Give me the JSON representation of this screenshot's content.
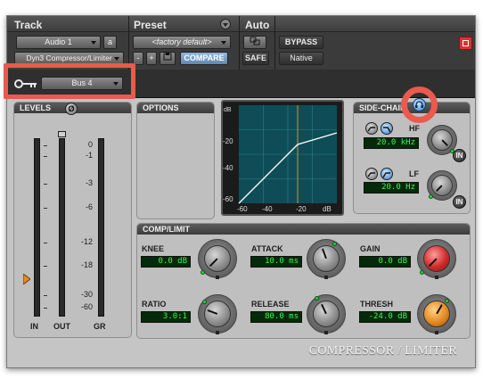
{
  "header": {
    "track_label": "Track",
    "preset_label": "Preset",
    "auto_label": "Auto",
    "track_name": "Audio 1",
    "track_channel": "a",
    "insert_name": "Dyn3 Compressor/Limiter",
    "preset_name": "<factory default>",
    "minus_label": "-",
    "plus_label": "+",
    "compare_label": "COMPARE",
    "bypass_label": "BYPASS",
    "safe_label": "SAFE",
    "native_label": "Native"
  },
  "keyinput": {
    "value": "Bus 4"
  },
  "levels": {
    "title": "LEVELS",
    "phase_icon": "Ø",
    "scale": [
      "0",
      "-1",
      "-3",
      "-6",
      "-12",
      "-18",
      "-30",
      "-60"
    ],
    "labels": [
      "IN",
      "OUT",
      "GR"
    ]
  },
  "options": {
    "title": "OPTIONS"
  },
  "graph": {
    "y_ticks": [
      "dB",
      "-20",
      "-40",
      "-60"
    ],
    "x_ticks": [
      "-60",
      "-40",
      "-20",
      "dB"
    ]
  },
  "sidechain": {
    "title": "SIDE-CHAIN",
    "hf_label": "HF",
    "hf_value": "20.0 kHz",
    "lf_label": "LF",
    "lf_value": "20.0 Hz",
    "in_label": "IN"
  },
  "comp": {
    "title": "COMP/LIMIT",
    "knee_label": "KNEE",
    "knee_value": "0.0 dB",
    "attack_label": "ATTACK",
    "attack_value": "10.0 ms",
    "gain_label": "GAIN",
    "gain_value": "0.0 dB",
    "ratio_label": "RATIO",
    "ratio_value": "3.0:1",
    "release_label": "RELEASE",
    "release_value": "80.0 ms",
    "thresh_label": "THRESH",
    "thresh_value": "-24.0 dB"
  },
  "branding": "COMPRESSOR / LIMITER",
  "colors": {
    "highlight": "#ea5a4d",
    "lcd_text": "#3df55a",
    "accent_blue": "#5f87b0",
    "gain_knob": "#d02b2b",
    "thresh_knob": "#e48a22"
  }
}
